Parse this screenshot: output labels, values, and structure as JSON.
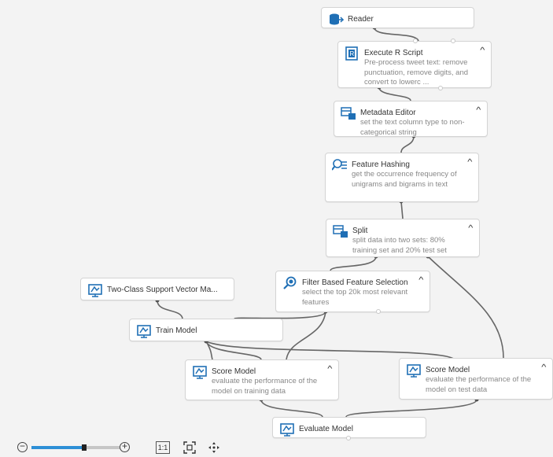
{
  "modules": {
    "reader": {
      "title": "Reader",
      "desc": ""
    },
    "execute_r": {
      "title": "Execute R Script",
      "desc": "Pre-process tweet text: remove punctuation, remove digits, and convert to lowerc ..."
    },
    "metadata": {
      "title": "Metadata Editor",
      "desc": "set the text column type to non-categorical string"
    },
    "feature_hashing": {
      "title": "Feature Hashing",
      "desc": "get the occurrence frequency of unigrams and bigrams in text"
    },
    "split": {
      "title": "Split",
      "desc": "split data into two sets: 80% training set and 20% test set"
    },
    "svm": {
      "title": "Two-Class Support Vector Ma...",
      "desc": ""
    },
    "filter": {
      "title": "Filter Based Feature Selection",
      "desc": "select the top 20k most relevant features"
    },
    "train": {
      "title": "Train Model",
      "desc": ""
    },
    "score_train": {
      "title": "Score Model",
      "desc": "evaluate the performance of the model on training data"
    },
    "score_test": {
      "title": "Score Model",
      "desc": "evaluate the performance of the model on test data"
    },
    "evaluate": {
      "title": "Evaluate Model",
      "desc": ""
    }
  },
  "toolbar": {
    "zoom_out": "−",
    "zoom_in": "+",
    "zoom_level": 0.55,
    "actual_size": "1:1",
    "fit_icon": "fit-to-screen-icon",
    "pan_icon": "pan-icon"
  },
  "colors": {
    "canvas": "#f3f3f3",
    "module_border": "#d4d4d4",
    "icon_blue": "#1f6fb5",
    "wire": "#666666",
    "zoom_fill": "#2d8fd6"
  }
}
